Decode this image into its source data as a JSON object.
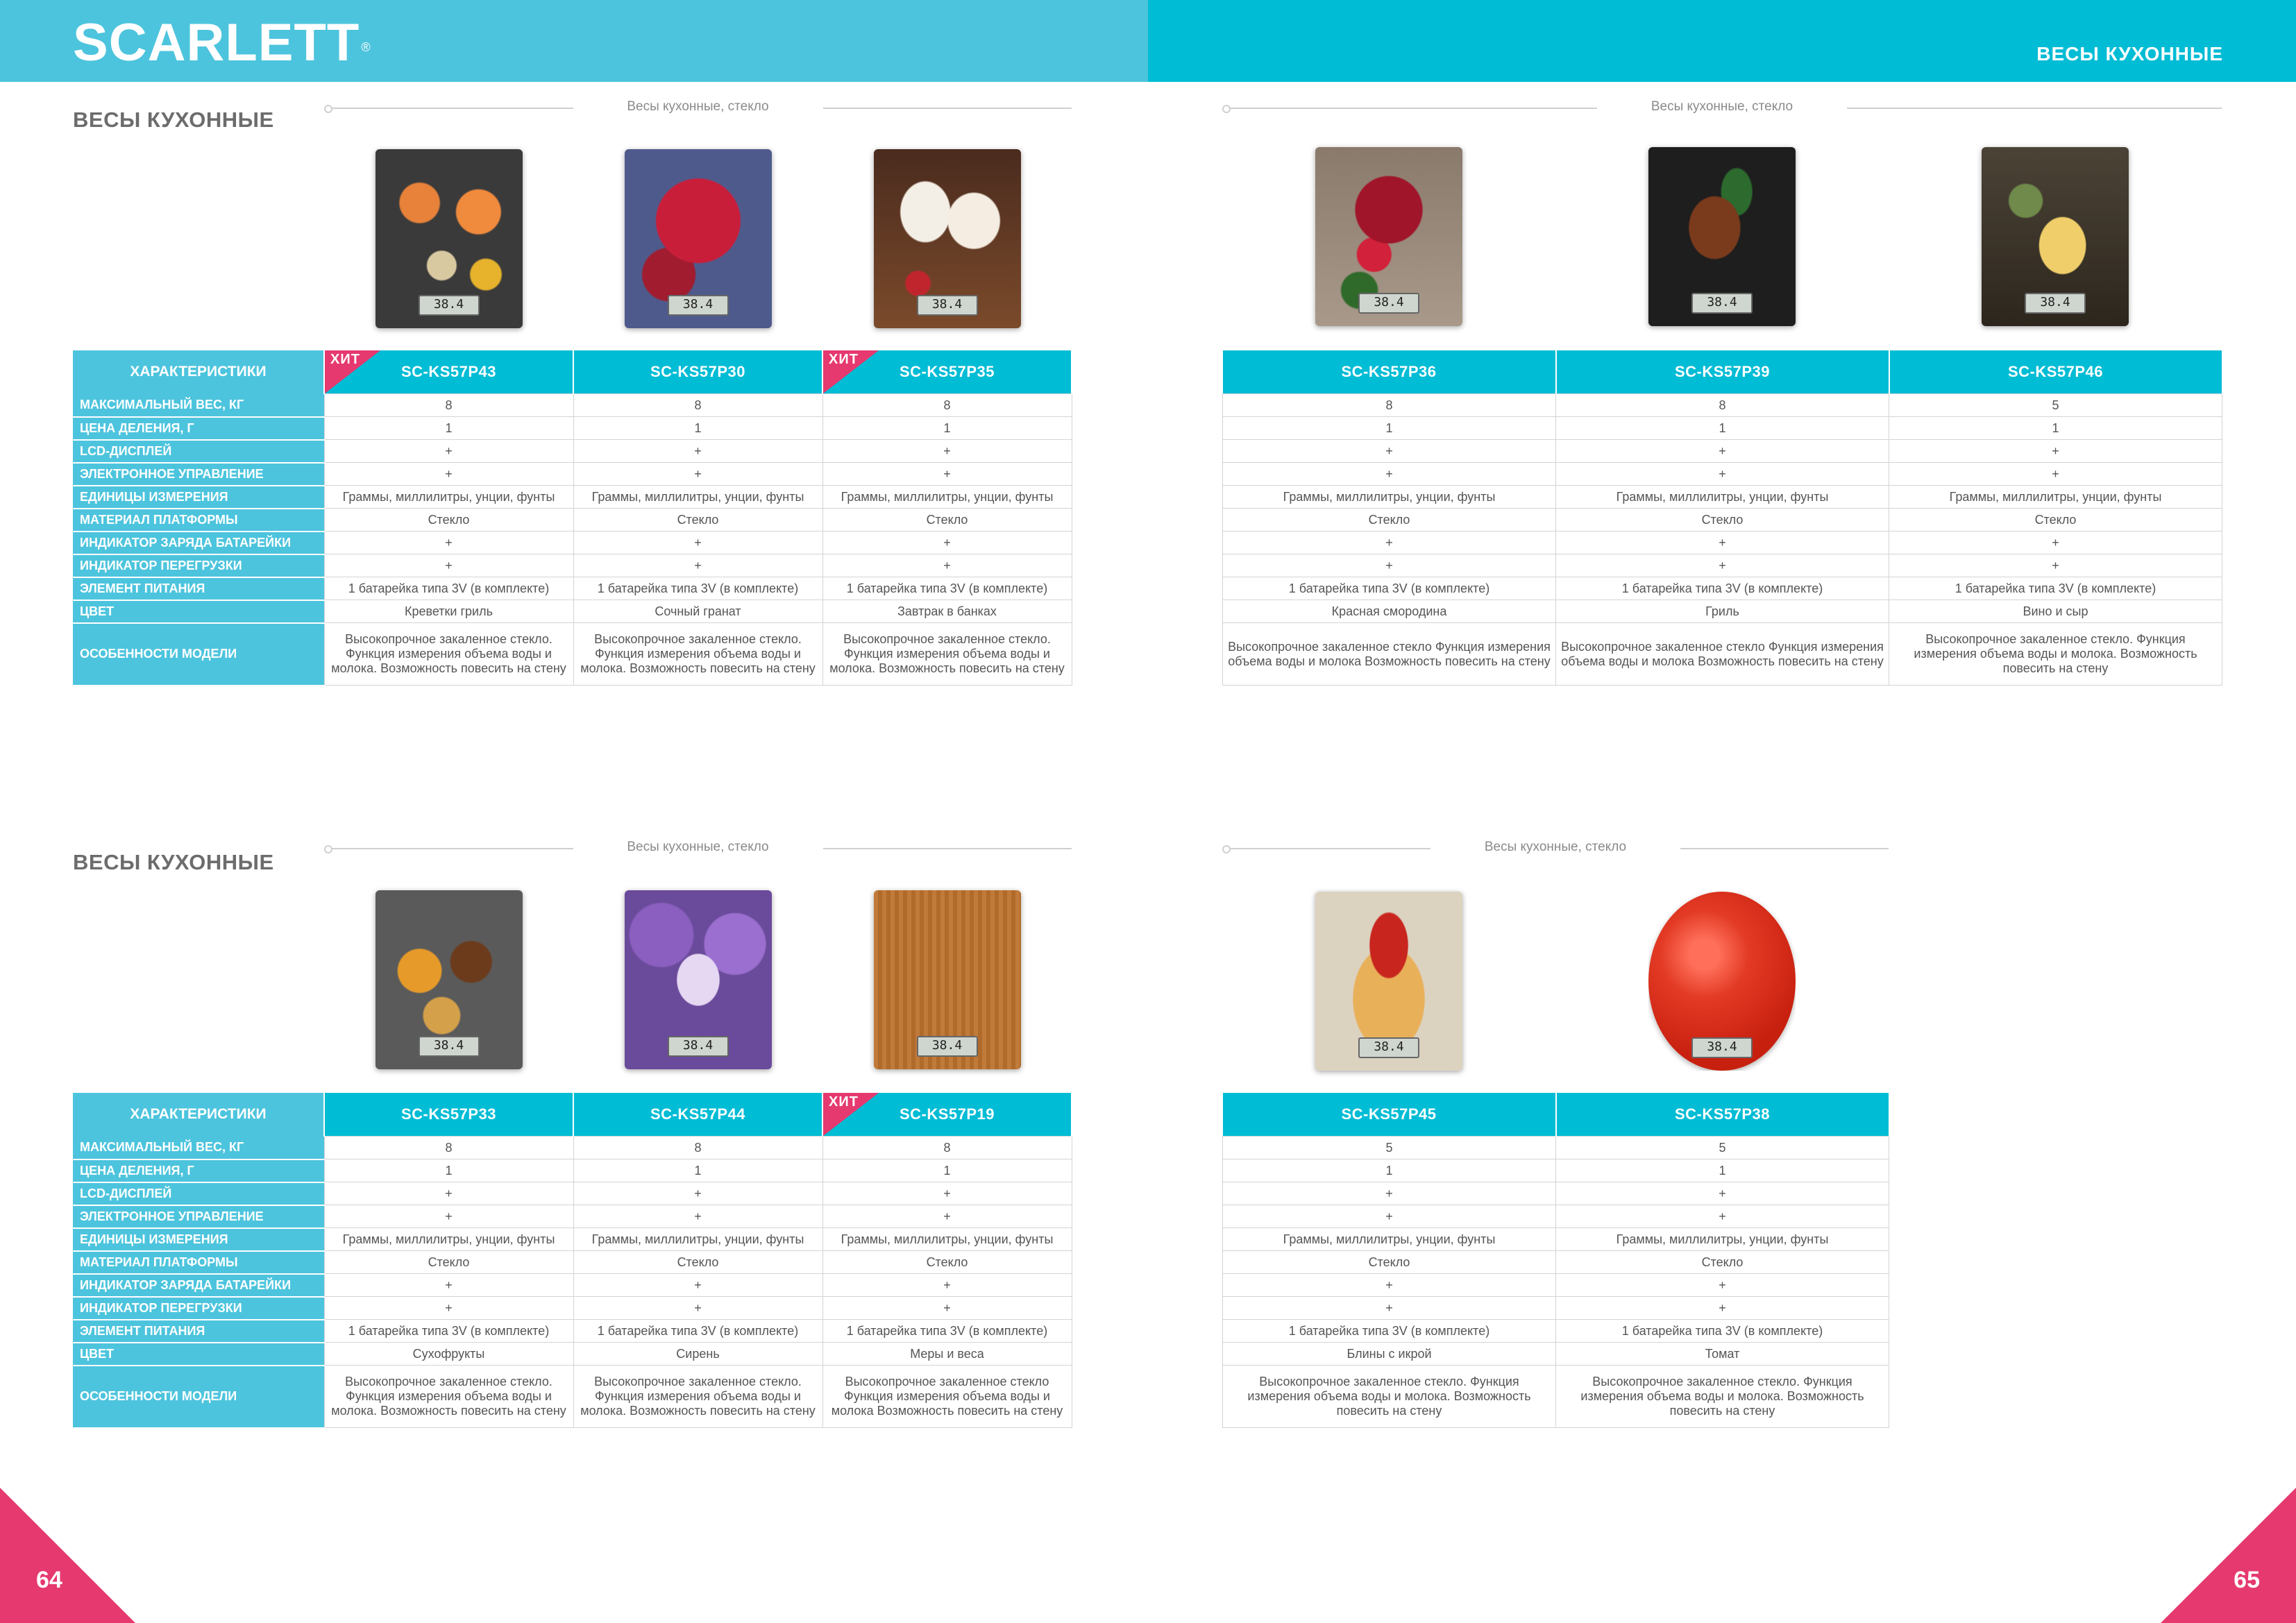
{
  "header": {
    "logo": "SCARLETT",
    "logo_mark": "®",
    "title": "ВЕСЫ КУХОННЫЕ"
  },
  "colors": {
    "header_left": "#4dc4dd",
    "header_right": "#00bcd5",
    "label_column": "#4dc4dd",
    "model_header": "#00bcd5",
    "hit_badge": "#e5396f",
    "corner": "#e5396f"
  },
  "row_labels": [
    "МАКСИМАЛЬНЫЙ ВЕС, КГ",
    "ЦЕНА ДЕЛЕНИЯ, Г",
    "LCD-ДИСПЛЕЙ",
    "ЭЛЕКТРОННОЕ УПРАВЛЕНИЕ",
    "ЕДИНИЦЫ ИЗМЕРЕНИЯ",
    "МАТЕРИАЛ ПЛАТФОРМЫ",
    "ИНДИКАТОР ЗАРЯДА БАТАРЕЙКИ",
    "ИНДИКАТОР ПЕРЕГРУЗКИ",
    "ЭЛЕМЕНТ ПИТАНИЯ",
    "ЦВЕТ",
    "ОСОБЕННОСТИ МОДЕЛИ"
  ],
  "sections": [
    {
      "title": "ВЕСЫ КУХОННЫЕ",
      "category": "Весы кухонные, стекло",
      "head_label": "ХАРАКТЕРИСТИКИ",
      "products": [
        {
          "model": "SC-KS57P43",
          "hit": "ХИТ",
          "lcd": "38.4",
          "image": "shrimp-scale",
          "values": [
            "8",
            "1",
            "+",
            "+",
            "Граммы, миллилитры, унции, фунты",
            "Стекло",
            "+",
            "+",
            "1 батарейка типа 3V (в комплекте)",
            "Креветки гриль",
            "Высокопрочное закаленное стекло. Функция измерения объема воды и молока. Возможность повесить на стену"
          ]
        },
        {
          "model": "SC-KS57P30",
          "hit": "",
          "lcd": "38.4",
          "image": "pomegranate-scale",
          "values": [
            "8",
            "1",
            "+",
            "+",
            "Граммы, миллилитры, унции, фунты",
            "Стекло",
            "+",
            "+",
            "1 батарейка типа 3V (в комплекте)",
            "Сочный гранат",
            "Высокопрочное закаленное стекло. Функция измерения объема воды и молока. Возможность повесить на стену"
          ]
        },
        {
          "model": "SC-KS57P35",
          "hit": "ХИТ",
          "lcd": "38.4",
          "image": "breakfast-scale",
          "values": [
            "8",
            "1",
            "+",
            "+",
            "Граммы, миллилитры, унции, фунты",
            "Стекло",
            "+",
            "+",
            "1 батарейка типа 3V (в комплекте)",
            "Завтрак в банках",
            "Высокопрочное закаленное стекло. Функция измерения объема воды и молока. Возможность повесить на стену"
          ]
        }
      ]
    },
    {
      "title": "",
      "category": "Весы кухонные, стекло",
      "head_label": "",
      "products": [
        {
          "model": "SC-KS57P36",
          "hit": "",
          "lcd": "38.4",
          "image": "redcurrant-scale",
          "values": [
            "8",
            "1",
            "+",
            "+",
            "Граммы, миллилитры, унции, фунты",
            "Стекло",
            "+",
            "+",
            "1 батарейка типа 3V (в комплекте)",
            "Красная смородина",
            "Высокопрочное закаленное стекло Функция измерения объема воды и молока Возможность повесить на стену"
          ]
        },
        {
          "model": "SC-KS57P39",
          "hit": "",
          "lcd": "38.4",
          "image": "grill-scale",
          "values": [
            "8",
            "1",
            "+",
            "+",
            "Граммы, миллилитры, унции, фунты",
            "Стекло",
            "+",
            "+",
            "1 батарейка типа 3V (в комплекте)",
            "Гриль",
            "Высокопрочное закаленное стекло Функция измерения объема воды и молока Возможность повесить на стену"
          ]
        },
        {
          "model": "SC-KS57P46",
          "hit": "",
          "lcd": "38.4",
          "image": "wine-cheese-scale",
          "values": [
            "5",
            "1",
            "+",
            "+",
            "Граммы, миллилитры, унции, фунты",
            "Стекло",
            "+",
            "+",
            "1 батарейка типа 3V (в комплекте)",
            "Вино и сыр",
            "Высокопрочное закаленное стекло. Функция измерения объема воды и молока. Возможность повесить на стену"
          ]
        }
      ]
    },
    {
      "title": "ВЕСЫ КУХОННЫЕ",
      "category": "Весы кухонные, стекло",
      "head_label": "ХАРАКТЕРИСТИКИ",
      "products": [
        {
          "model": "SC-KS57P33",
          "hit": "",
          "lcd": "38.4",
          "image": "dried-fruit-scale",
          "values": [
            "8",
            "1",
            "+",
            "+",
            "Граммы, миллилитры, унции, фунты",
            "Стекло",
            "+",
            "+",
            "1 батарейка типа 3V (в комплекте)",
            "Сухофрукты",
            "Высокопрочное закаленное стекло. Функция измерения объема воды и молока. Возможность повесить на стену"
          ]
        },
        {
          "model": "SC-KS57P44",
          "hit": "",
          "lcd": "38.4",
          "image": "lilac-scale",
          "values": [
            "8",
            "1",
            "+",
            "+",
            "Граммы, миллилитры, унции, фунты",
            "Стекло",
            "+",
            "+",
            "1 батарейка типа 3V (в комплекте)",
            "Сирень",
            "Высокопрочное закаленное стекло. Функция измерения объема воды и молока. Возможность повесить на стену"
          ]
        },
        {
          "model": "SC-KS57P19",
          "hit": "ХИТ",
          "lcd": "38.4",
          "image": "measures-scale",
          "values": [
            "8",
            "1",
            "+",
            "+",
            "Граммы, миллилитры, унции, фунты",
            "Стекло",
            "+",
            "+",
            "1 батарейка типа 3V (в комплекте)",
            "Меры и веса",
            "Высокопрочное закаленное стекло Функция измерения объема воды и молока Возможность повесить на стену"
          ]
        }
      ]
    },
    {
      "title": "",
      "category": "Весы кухонные, стекло",
      "head_label": "",
      "products": [
        {
          "model": "SC-KS57P45",
          "hit": "",
          "lcd": "38.4",
          "image": "pancakes-scale",
          "values": [
            "5",
            "1",
            "+",
            "+",
            "Граммы, миллилитры, унции, фунты",
            "Стекло",
            "+",
            "+",
            "1 батарейка типа 3V (в комплекте)",
            "Блины с икрой",
            "Высокопрочное закаленное стекло. Функция измерения объема воды и молока. Возможность повесить на стену"
          ]
        },
        {
          "model": "SC-KS57P38",
          "hit": "",
          "lcd": "38.4",
          "image": "tomato-scale",
          "values": [
            "5",
            "1",
            "+",
            "+",
            "Граммы, миллилитры, унции, фунты",
            "Стекло",
            "+",
            "+",
            "1 батарейка типа 3V (в комплекте)",
            "Томат",
            "Высокопрочное закаленное стекло. Функция измерения объема воды и молока. Возможность повесить на стену"
          ]
        }
      ]
    }
  ],
  "page_numbers": {
    "left": "64",
    "right": "65"
  }
}
